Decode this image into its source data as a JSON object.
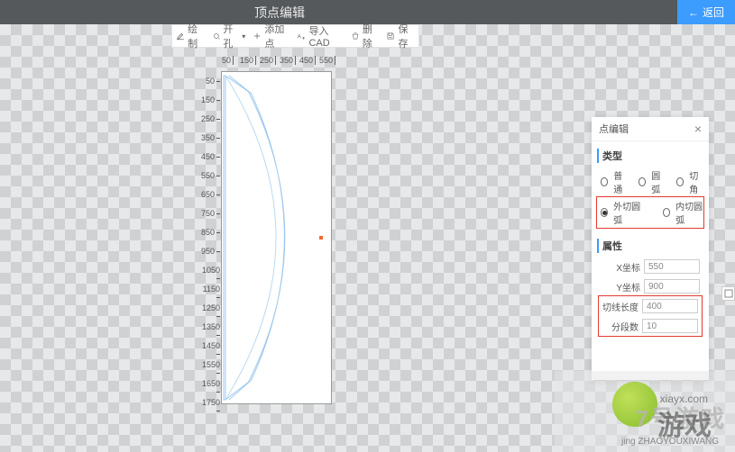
{
  "topbar": {
    "title": "顶点编辑",
    "back_label": "返回"
  },
  "toolbar": {
    "items": [
      {
        "label": "绘制",
        "icon": "edit-icon"
      },
      {
        "label": "开孔",
        "icon": "hole-icon"
      },
      {
        "label": "添加点",
        "icon": "add-point-icon"
      },
      {
        "label": "导入CAD",
        "icon": "import-icon"
      },
      {
        "label": "删除",
        "icon": "delete-icon"
      },
      {
        "label": "保存",
        "icon": "save-icon"
      }
    ]
  },
  "ruler": {
    "h": [
      "50",
      "150",
      "250",
      "350",
      "450",
      "550"
    ],
    "v": [
      "50",
      "150",
      "250",
      "350",
      "450",
      "550",
      "650",
      "750",
      "850",
      "950",
      "1050",
      "1150",
      "1250",
      "1350",
      "1450",
      "1550",
      "1650",
      "1750"
    ]
  },
  "panel": {
    "title": "点编辑",
    "type_label": "类型",
    "types": {
      "normal": "普通",
      "arc": "圆弧",
      "chamfer": "切角",
      "outer_arc": "外切圆弧",
      "inner_arc": "内切圆弧"
    },
    "selected_type": "outer_arc",
    "props_label": "属性",
    "props": {
      "x_label": "X坐标",
      "x_value": "550",
      "y_label": "Y坐标",
      "y_value": "900",
      "tangent_label": "切线长度",
      "tangent_value": "400",
      "segments_label": "分段数",
      "segments_value": "10"
    }
  },
  "watermark": {
    "brand1": "7号游戏",
    "brand2": "游戏",
    "url": "xiayx.com",
    "pin": "jing ZHAOYOUXIWANG"
  }
}
